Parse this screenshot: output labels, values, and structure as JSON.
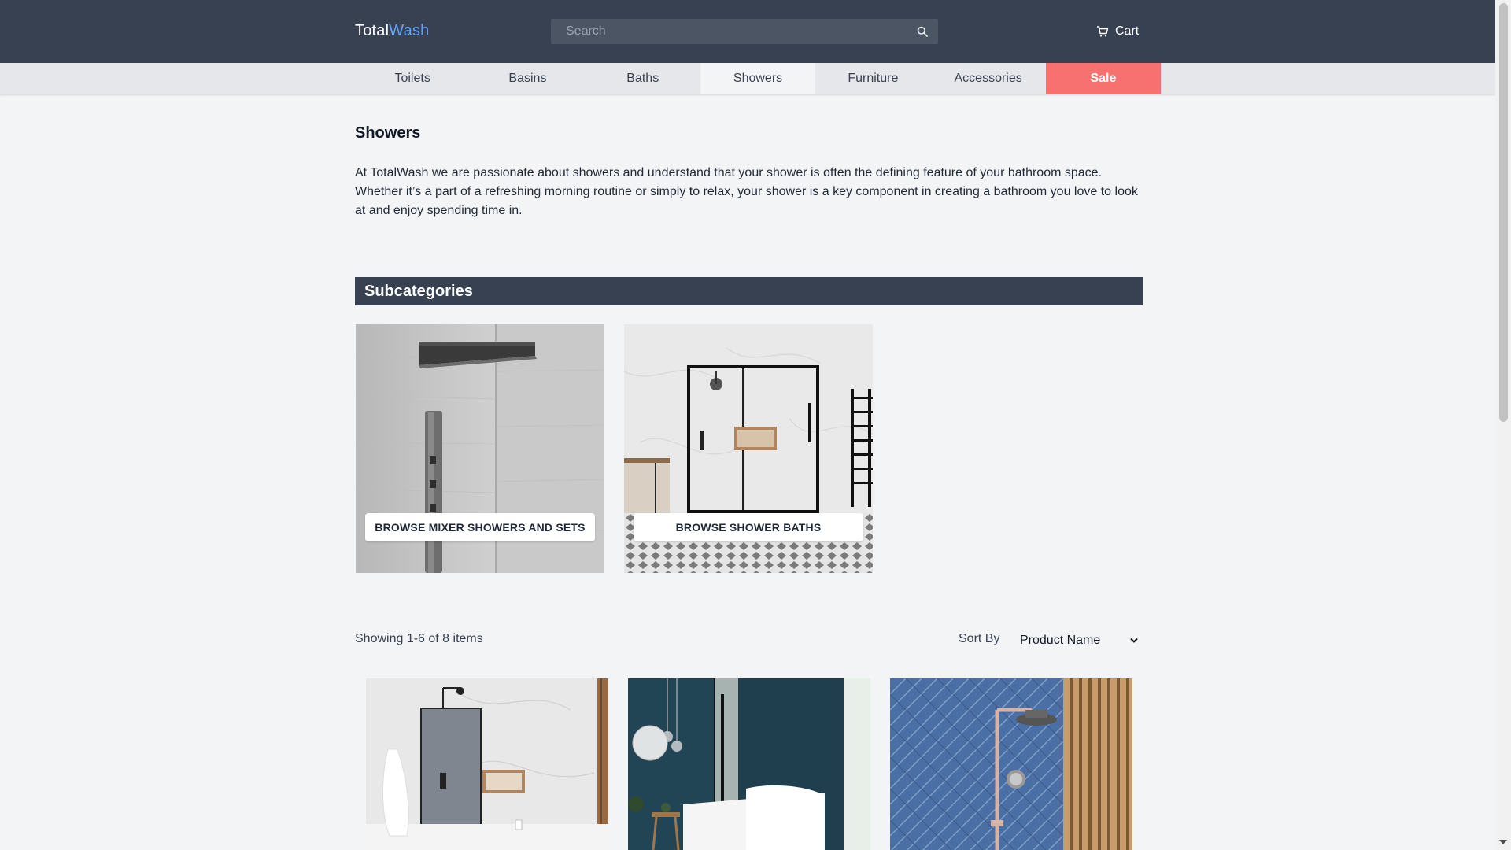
{
  "header": {
    "logo_part1": "Total",
    "logo_part2": "Wash",
    "search_placeholder": "Search",
    "cart_label": "Cart"
  },
  "nav": {
    "items": [
      {
        "label": "Toilets"
      },
      {
        "label": "Basins"
      },
      {
        "label": "Baths"
      },
      {
        "label": "Showers",
        "active": true
      },
      {
        "label": "Furniture"
      },
      {
        "label": "Accessories"
      },
      {
        "label": "Sale",
        "highlight": true
      }
    ]
  },
  "page": {
    "title": "Showers",
    "intro": "At TotalWash we are passionate about showers and understand that your shower is often the defining feature of your bathroom space. Whether it’s a part of a refreshing morning routine or simply to relax, your shower is a key component in creating a bathroom you love to look at and enjoy spending time in."
  },
  "subcategories": {
    "heading": "Subcategories",
    "items": [
      {
        "label": "BROWSE MIXER SHOWERS AND SETS"
      },
      {
        "label": "BROWSE SHOWER BATHS"
      }
    ]
  },
  "listing": {
    "showing_text": "Showing 1-6 of 8 items",
    "sort_label": "Sort By",
    "sort_value": "Product Name"
  },
  "colors": {
    "header_bg": "#374151",
    "accent": "#60a5fa",
    "sale": "#f87171",
    "page_bg": "#f3f4f6"
  }
}
